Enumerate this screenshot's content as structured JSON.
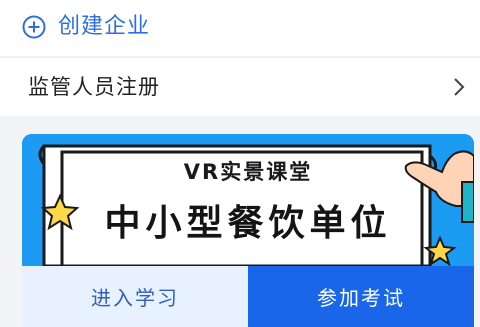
{
  "create": {
    "label": "创建企业",
    "icon": "plus-circle-icon",
    "color": "#2e6fe0"
  },
  "register": {
    "label": "监管人员注册",
    "icon": "chevron-right-icon"
  },
  "course": {
    "subtitle": "VR实景课堂",
    "title": "中小型餐饮单位",
    "learn_label": "进入学习",
    "exam_label": "参加考试",
    "accent": "#1a66e8"
  }
}
